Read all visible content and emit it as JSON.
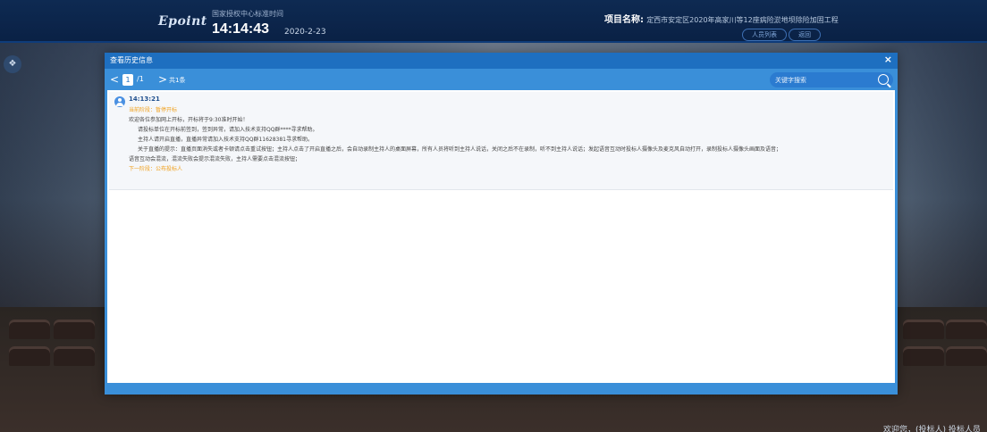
{
  "header": {
    "logo": "Epoint",
    "clock_label": "国家授权中心标准时间",
    "time": "14:14:43",
    "date": "2020-2-23",
    "project_label": "项目名称:",
    "project_name": "定西市安定区2020年高家川等12座病险淤地坝除险加固工程",
    "btn_people": "人员列表",
    "btn_back": "返回"
  },
  "footer": {
    "welcome": "欢迎您，(投标人) 投标人员"
  },
  "modal": {
    "title": "查看历史信息",
    "close": "×",
    "pager": {
      "prev": "<",
      "current": "1",
      "total": "/1",
      "next": ">",
      "count": "共1条"
    },
    "search": {
      "placeholder": "关键字搜索"
    },
    "message": {
      "time": "14:13:21",
      "stage": "当前阶段：暂停开标",
      "line1": "欢迎各位参加网上开标，开标将于9:30准时开始！",
      "line2": "请投标单位在开标前签到，签到异常，请加入技术支持QQ群****寻求帮助。",
      "line3": "主持人请开启直播，直播异常请加入技术支持QQ群1162838​1寻求帮助。",
      "line4": "关于直播的提示：直播页面消失或者卡顿请点击重试按钮；主持人点击了开启直播之后，会自动录制主持人的桌面屏幕，所有人员将听到主持人说话，关闭之后不在录制，听不到主持人说话；发起语音互动时投标人摄像头及麦克风自动打开，录制投标人摄像头画面及语音；",
      "line5": "语音互动会混流，混流失败会提示混流失败，主持人需要点击混流按钮；",
      "next_stage": "下一阶段：公布投标人"
    }
  }
}
